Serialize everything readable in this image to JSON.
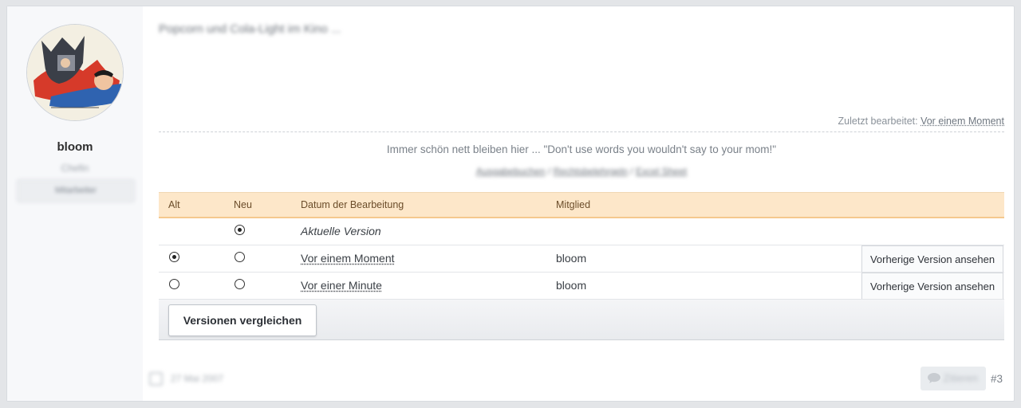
{
  "author": {
    "name": "bloom",
    "role": "Chefin",
    "badge": "Mitarbeiter"
  },
  "post": {
    "title": "Popcorn und Cola-Light im Kino ...",
    "last_edited_label": "Zuletzt bearbeitet:",
    "last_edited_value": "Vor einem Moment",
    "signature": "Immer schön nett bleiben hier ... \"Don't use words you wouldn't say to your mom!\"",
    "sig_links": [
      "Ausgabebuchen",
      "Rechtsbelehrgeln",
      "Excel Sheet"
    ],
    "sig_sep": "/"
  },
  "history": {
    "headers": {
      "alt": "Alt",
      "neu": "Neu",
      "datum": "Datum der Bearbeitung",
      "mitglied": "Mitglied"
    },
    "rows": [
      {
        "alt_selected": false,
        "alt_visible": false,
        "neu_selected": true,
        "datum": "Aktuelle Version",
        "mitglied": "",
        "view_label": ""
      },
      {
        "alt_selected": true,
        "alt_visible": true,
        "neu_selected": false,
        "datum": "Vor einem Moment",
        "mitglied": "bloom",
        "view_label": "Vorherige Version ansehen"
      },
      {
        "alt_selected": false,
        "alt_visible": true,
        "neu_selected": false,
        "datum": "Vor einer Minute",
        "mitglied": "bloom",
        "view_label": "Vorherige Version ansehen"
      }
    ],
    "compare_button": "Versionen vergleichen"
  },
  "footer": {
    "date": "27 Mai 2007",
    "quote_button": "Zitieren",
    "post_number": "#3"
  },
  "colors": {
    "header_bg": "#fde7c9",
    "header_border": "#f5c88e"
  }
}
